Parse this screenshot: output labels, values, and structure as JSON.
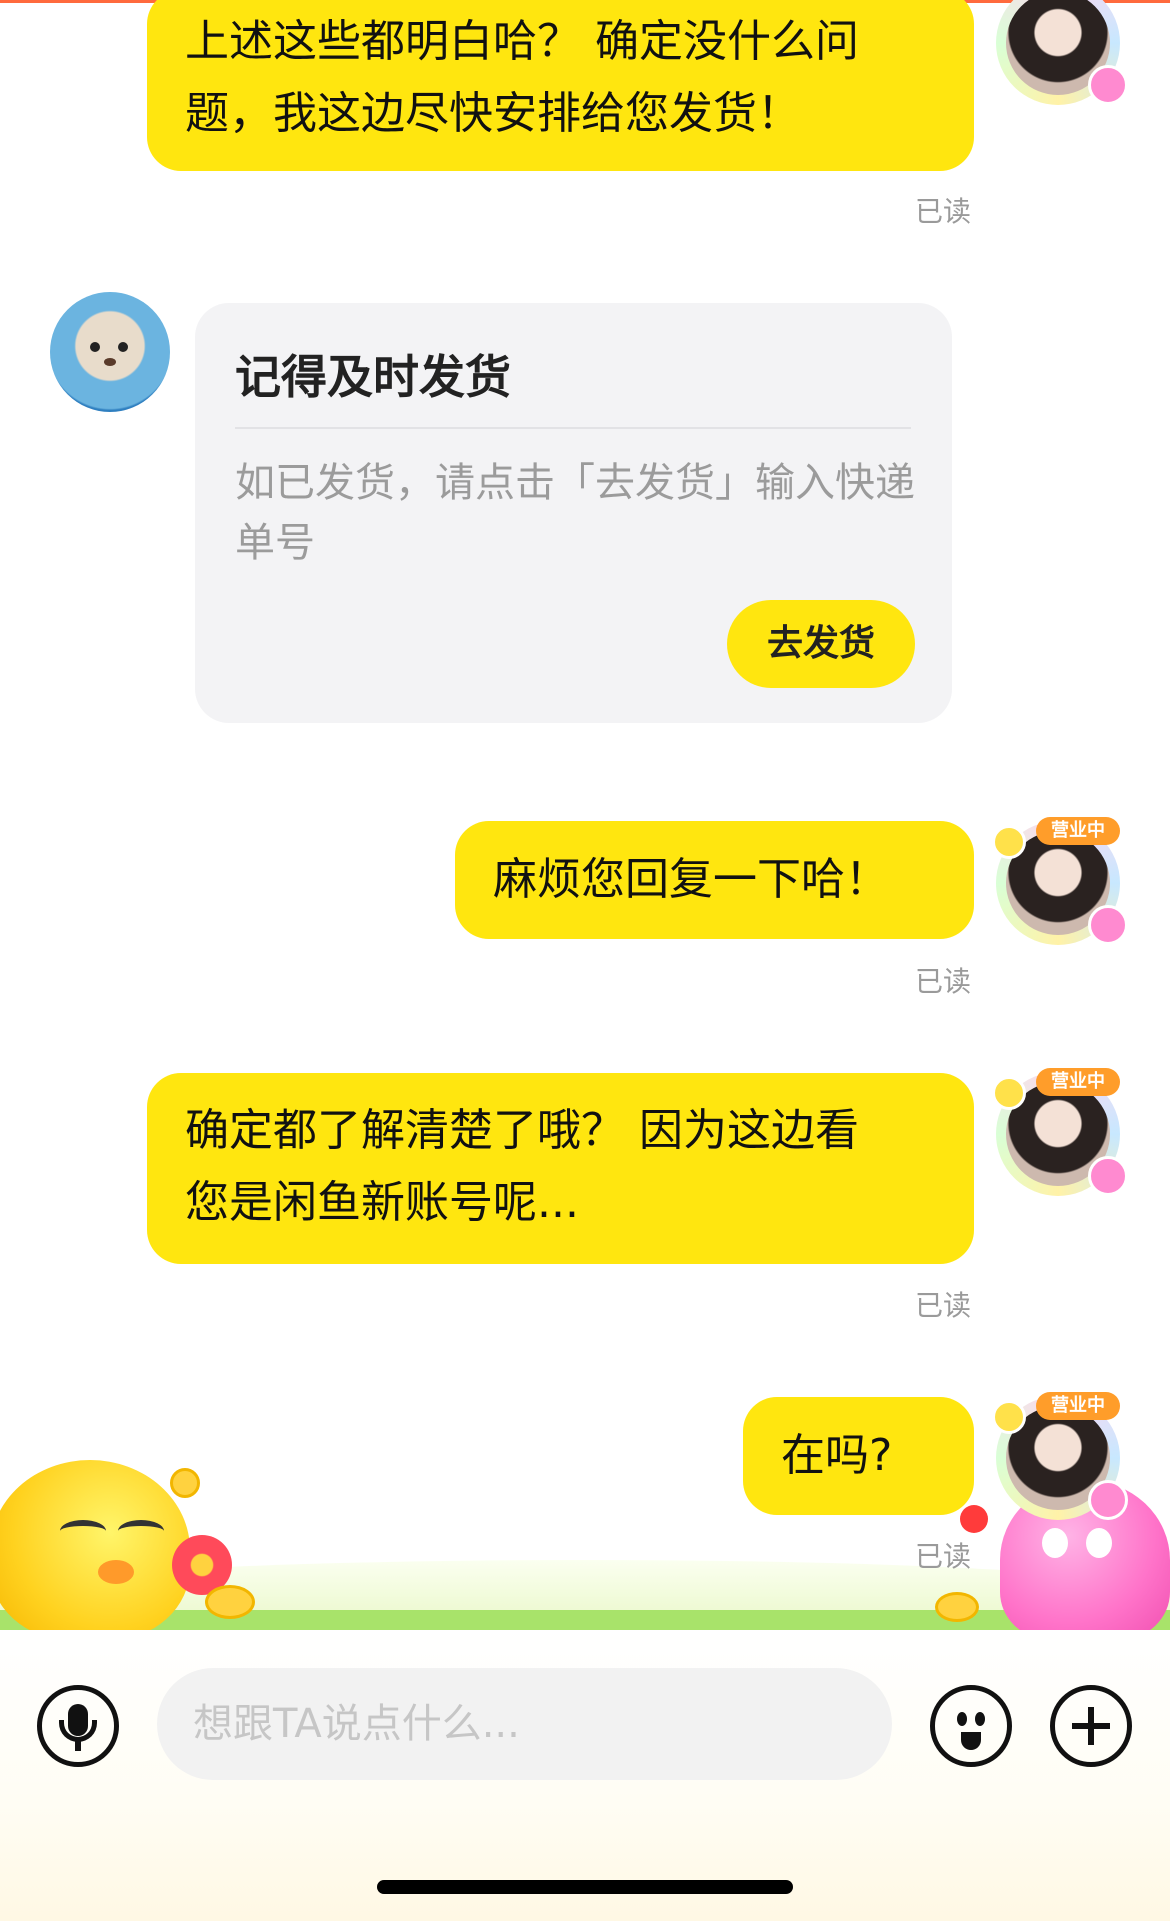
{
  "messages": [
    {
      "text_line1": "上述这些都明白哈？ 确定没什么问",
      "text_line2": "题，我这边尽快安排给您发货！",
      "status": "已读"
    },
    {
      "text": "麻烦您回复一下哈！",
      "status": "已读"
    },
    {
      "text_line1": "确定都了解清楚了哦？ 因为这边看",
      "text_line2": "您是闲鱼新账号呢...",
      "status": "已读"
    },
    {
      "text": "在吗?",
      "status": "已读"
    }
  ],
  "badge_label": "营业中",
  "system_card": {
    "title": "记得及时发货",
    "description": "如已发货，请点击「去发货」输入快递单号",
    "button_label": "去发货"
  },
  "input_bar": {
    "placeholder": "想跟TA说点什么...",
    "icons": [
      "microphone-icon",
      "emoji-icon",
      "plus-icon"
    ]
  },
  "colors": {
    "bubble": "#ffe60f",
    "card_bg": "#f3f3f5",
    "read_label": "#9a9a9a"
  }
}
